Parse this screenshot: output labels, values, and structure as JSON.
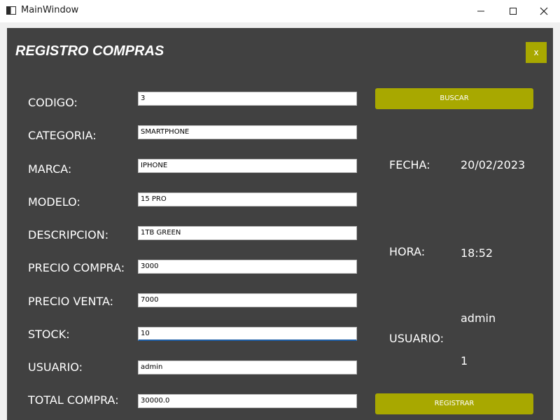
{
  "window": {
    "title": "MainWindow"
  },
  "header": {
    "title": "REGISTRO COMPRAS",
    "close_label": "x"
  },
  "form": {
    "fields": [
      {
        "label": "CODIGO:",
        "value": "3"
      },
      {
        "label": "CATEGORIA:",
        "value": "SMARTPHONE"
      },
      {
        "label": "MARCA:",
        "value": "IPHONE"
      },
      {
        "label": "MODELO:",
        "value": "15 PRO"
      },
      {
        "label": "DESCRIPCION:",
        "value": "1TB GREEN"
      },
      {
        "label": "PRECIO COMPRA:",
        "value": "3000"
      },
      {
        "label": "PRECIO VENTA:",
        "value": "7000"
      },
      {
        "label": "STOCK:",
        "value": "10"
      },
      {
        "label": "USUARIO:",
        "value": "admin"
      },
      {
        "label": "TOTAL COMPRA:",
        "value": "30000.0"
      }
    ]
  },
  "actions": {
    "search_label": "BUSCAR",
    "register_label": "REGISTRAR"
  },
  "info": {
    "date_label": "FECHA:",
    "date_value": "20/02/2023",
    "time_label": "HORA:",
    "time_value": "18:52",
    "user_label": "USUARIO:",
    "user_name": "admin",
    "user_id": "1"
  },
  "colors": {
    "panel_bg": "#414141",
    "accent": "#a8a800",
    "focus_border": "#1f5fa6"
  }
}
